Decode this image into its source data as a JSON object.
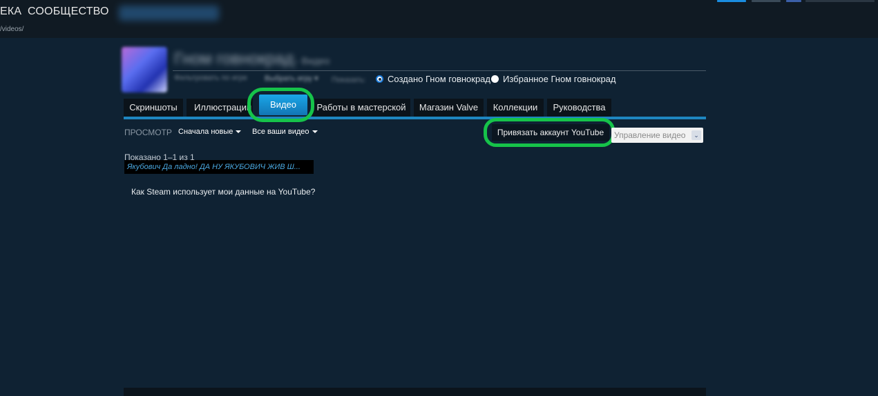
{
  "nav": {
    "library_partial": "ЕКА",
    "community": "СООБЩЕСТВО",
    "url_tail": "/videos/"
  },
  "profile": {
    "name": "Гном говнокрад",
    "suffix": "- Видео"
  },
  "filters_bar": {
    "filter_by_game": "Фильтровать по игре",
    "choose_game": "Выбрать игру ▾",
    "show_label": "Показать:",
    "created_by": "Создано Гном говнокрад",
    "favorites_of": "Избранное Гном говнокрад"
  },
  "tabs": [
    {
      "label": "Скриншоты"
    },
    {
      "label": "Иллюстрации"
    },
    {
      "label": "Видео"
    },
    {
      "label": "Работы в мастерской"
    },
    {
      "label": "Магазин Valve"
    },
    {
      "label": "Коллекции"
    },
    {
      "label": "Руководства"
    }
  ],
  "view": {
    "label": "ПРОСМОТР",
    "sort": "Сначала новые",
    "scope": "Все ваши видео"
  },
  "actions": {
    "link_youtube": "Привязать аккаунт YouTube",
    "manage_videos": "Управление видео"
  },
  "results": {
    "shown": "Показано 1–1 из 1",
    "video_title": "Якубович Да ладно! ДА НУ ЯКУБОВИЧ ЖИВ Ш...",
    "youtube_data_question": "Как Steam использует мои данные на YouTube?"
  },
  "colors": {
    "highlight": "#16c34a",
    "active_tab": "#1aa7e8",
    "background": "#0f2233"
  }
}
